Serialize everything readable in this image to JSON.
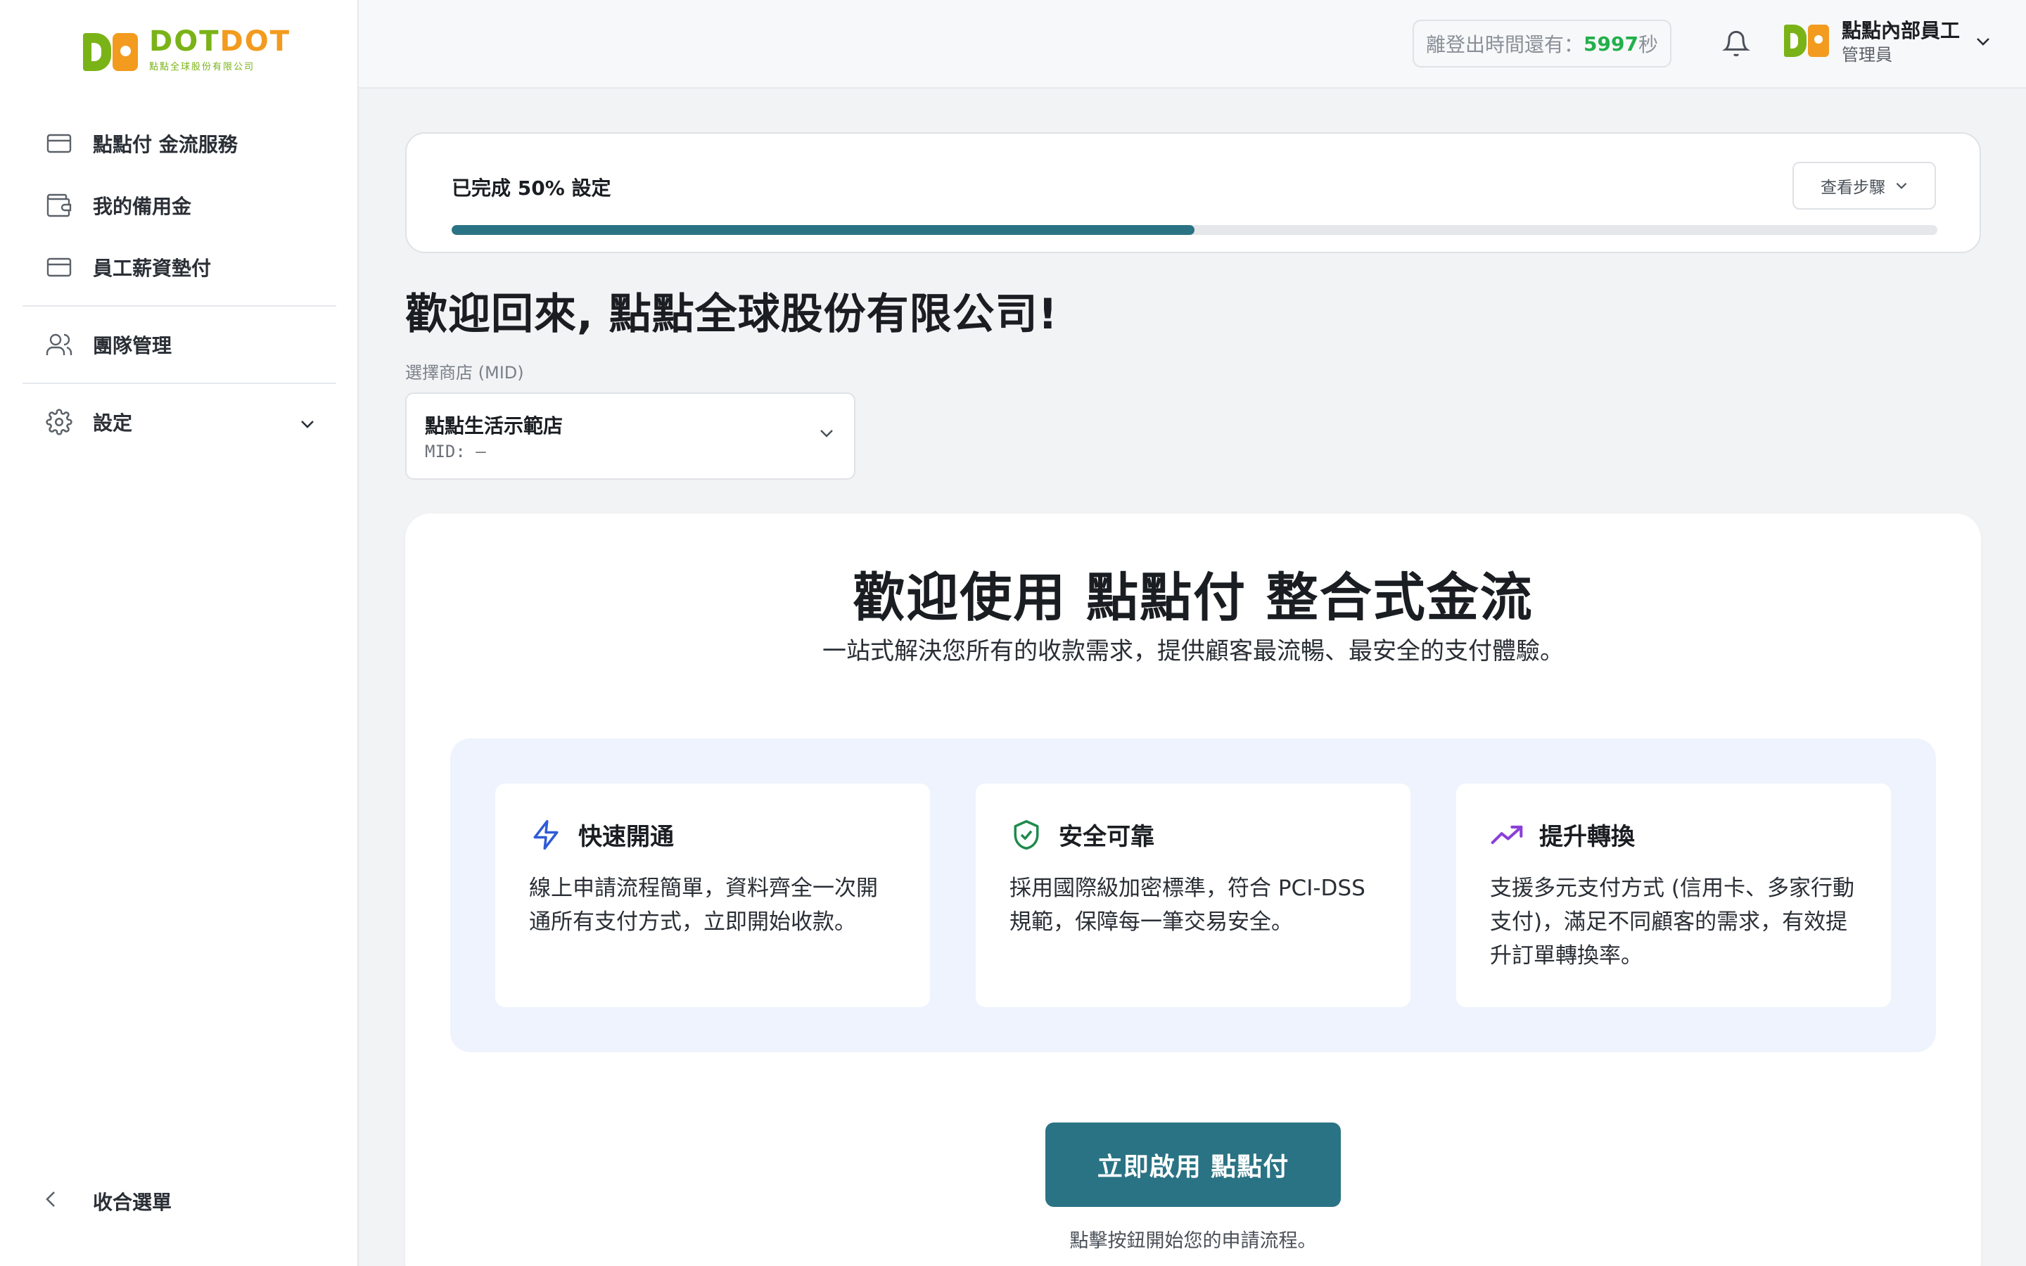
{
  "brand": {
    "name_part1": "DOT",
    "name_part2": "DOT",
    "subtitle": "點點全球股份有限公司",
    "colors": {
      "green": "#7ab317",
      "orange": "#f29b1e",
      "primary": "#2a7384"
    }
  },
  "sidebar": {
    "items": [
      {
        "label": "點點付 金流服務",
        "icon": "credit-card-icon"
      },
      {
        "label": "我的備用金",
        "icon": "wallet-icon"
      },
      {
        "label": "員工薪資墊付",
        "icon": "credit-card-icon"
      },
      {
        "label": "團隊管理",
        "icon": "users-icon"
      },
      {
        "label": "設定",
        "icon": "gear-icon"
      }
    ],
    "collapse_label": "收合選單"
  },
  "topbar": {
    "timer_prefix": "離登出時間還有：",
    "timer_value": "5997",
    "timer_suffix": "秒",
    "user_name": "點點內部員工",
    "user_role": "管理員"
  },
  "progress": {
    "title": "已完成 50% 設定",
    "percent": 50,
    "steps_button": "查看步驟"
  },
  "welcome": {
    "title": "歡迎回來, 點點全球股份有限公司!",
    "mid_label": "選擇商店 (MID)",
    "store_name": "點點生活示範店",
    "store_mid": "MID: —"
  },
  "main": {
    "hero_title": "歡迎使用 點點付 整合式金流",
    "hero_subtitle": "一站式解決您所有的收款需求，提供顧客最流暢、最安全的支付體驗。",
    "features": [
      {
        "title": "快速開通",
        "description": "線上申請流程簡單，資料齊全一次開通所有支付方式，立即開始收款。",
        "icon": "lightning-icon",
        "color": "#2f5bd6"
      },
      {
        "title": "安全可靠",
        "description": "採用國際級加密標準，符合 PCI-DSS 規範，保障每一筆交易安全。",
        "icon": "shield-check-icon",
        "color": "#1f8a4c"
      },
      {
        "title": "提升轉換",
        "description": "支援多元支付方式 (信用卡、多家行動支付)，滿足不同顧客的需求，有效提升訂單轉換率。",
        "icon": "trending-up-icon",
        "color": "#8b3fd6"
      }
    ],
    "cta_label": "立即啟用 點點付",
    "cta_hint": "點擊按鈕開始您的申請流程。"
  }
}
